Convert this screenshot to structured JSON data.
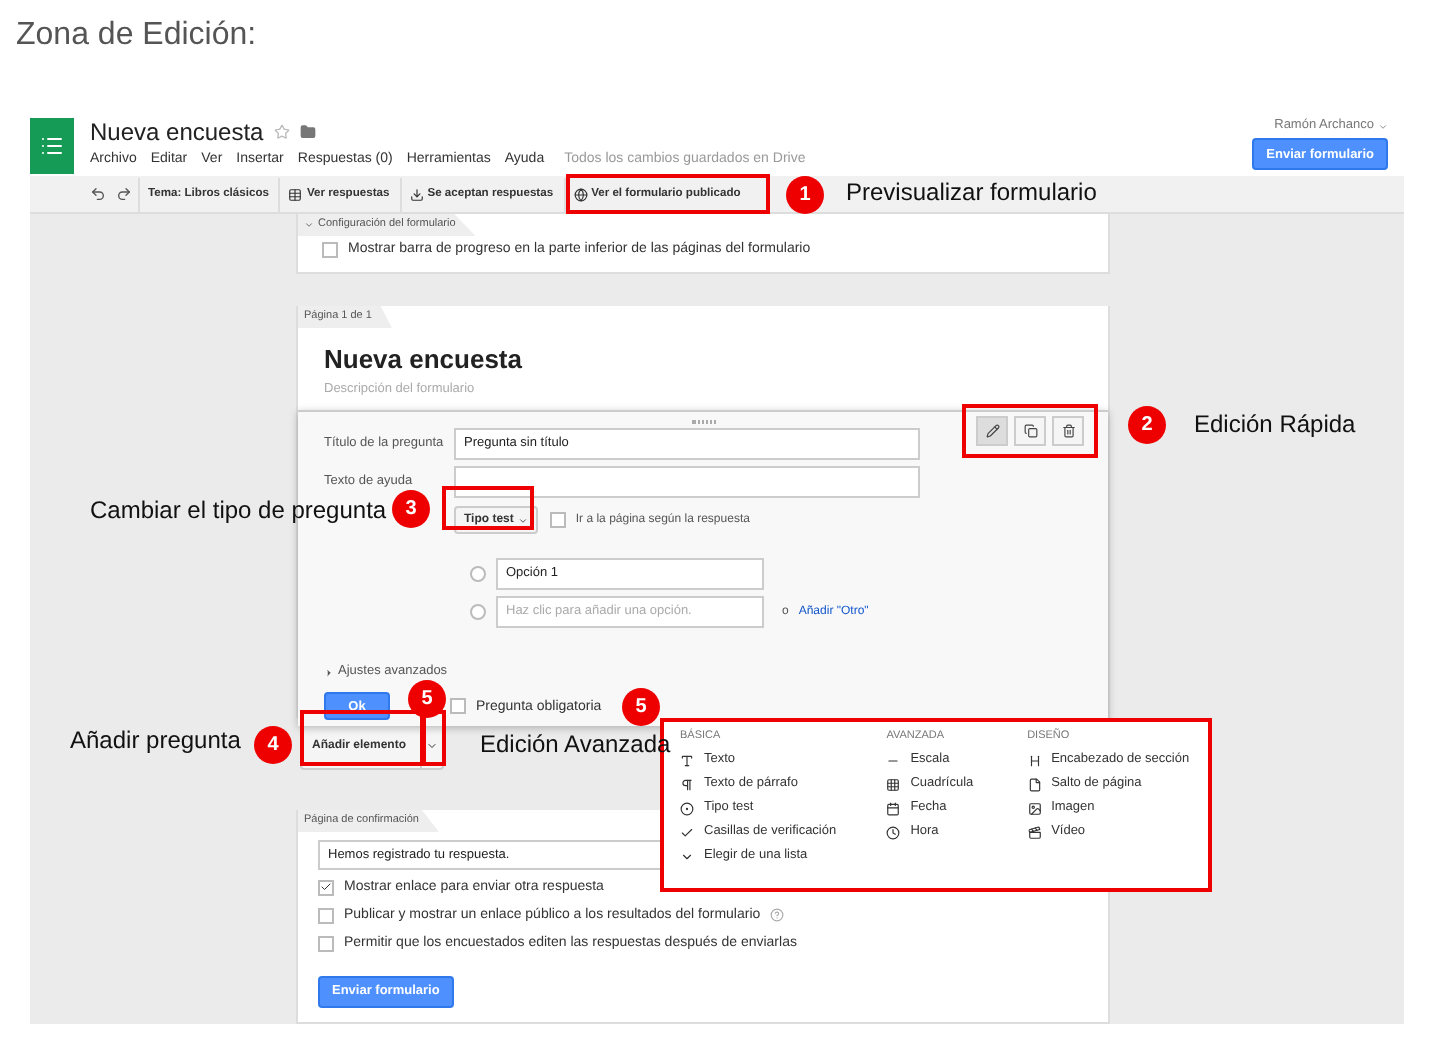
{
  "heading": "Zona de Edición:",
  "app": {
    "title": "Nueva encuesta",
    "starred": false,
    "menu": [
      "Archivo",
      "Editar",
      "Ver",
      "Insertar",
      "Respuestas (0)",
      "Herramientas",
      "Ayuda"
    ],
    "save_status": "Todos los cambios guardados en Drive",
    "user": "Ramón Archanco",
    "send_button": "Enviar formulario"
  },
  "toolbar": [
    {
      "kind": "text",
      "label": "Tema: Libros clásicos"
    },
    {
      "kind": "table",
      "label": "Ver respuestas"
    },
    {
      "kind": "inbox",
      "label": "Se aceptan respuestas"
    },
    {
      "kind": "globe",
      "label": "Ver el formulario publicado"
    }
  ],
  "settings": {
    "tab": "Configuración del formulario",
    "expanded": true,
    "options": [
      {
        "label": "Mostrar barra de progreso en la parte inferior de las páginas del formulario",
        "checked": false
      }
    ]
  },
  "page": {
    "tab": "Página 1 de 1",
    "title": "Nueva encuesta",
    "description": "Descripción del formulario"
  },
  "question_editor": {
    "fields": [
      {
        "label": "Título de la pregunta",
        "value": "Pregunta sin título"
      },
      {
        "label": "Texto de ayuda"
      }
    ],
    "type_button": "Tipo test",
    "page_jump": {
      "label": "Ir a la página según la respuesta",
      "checked": false
    },
    "options": [
      {
        "value": "Opción 1",
        "selected": false
      },
      {
        "placeholder": "Haz clic para añadir una opción.",
        "selected": false
      }
    ],
    "add_other_prefix": "o",
    "add_other_link": "Añadir \"Otro\"",
    "advanced": "Ajustes avanzados",
    "ok_button": "Ok",
    "required": {
      "label": "Pregunta obligatoria",
      "checked": false
    }
  },
  "add_item_button": "Añadir elemento",
  "confirmation": {
    "tab": "Página de confirmación",
    "message": "Hemos registrado tu respuesta.",
    "options": [
      {
        "label": "Mostrar enlace para enviar otra respuesta",
        "checked": true
      },
      {
        "label": "Publicar y mostrar un enlace público a los resultados del formulario",
        "checked": false,
        "help": true
      },
      {
        "label": "Permitir que los encuestados editen las respuestas después de enviarlas",
        "checked": false
      }
    ],
    "send_button": "Enviar formulario"
  },
  "insert_menu": {
    "columns": [
      {
        "heading": "BÁSICA",
        "items": [
          {
            "kind": "text",
            "label": "Texto"
          },
          {
            "kind": "paragraph",
            "label": "Texto de párrafo"
          },
          {
            "kind": "radio",
            "label": "Tipo test"
          },
          {
            "kind": "checkbox",
            "label": "Casillas de verificación"
          },
          {
            "kind": "list",
            "label": "Elegir de una lista"
          }
        ]
      },
      {
        "heading": "AVANZADA",
        "items": [
          {
            "kind": "scale",
            "label": "Escala"
          },
          {
            "kind": "grid",
            "label": "Cuadrícula"
          },
          {
            "kind": "date",
            "label": "Fecha"
          },
          {
            "kind": "time",
            "label": "Hora"
          }
        ]
      },
      {
        "heading": "DISEÑO",
        "items": [
          {
            "kind": "header",
            "label": "Encabezado de sección"
          },
          {
            "kind": "pagebreak",
            "label": "Salto de página"
          },
          {
            "kind": "image",
            "label": "Imagen"
          },
          {
            "kind": "video",
            "label": "Vídeo"
          }
        ]
      }
    ]
  },
  "callouts": [
    {
      "number": "1",
      "label": "Previsualizar formulario"
    },
    {
      "number": "2",
      "label": "Edición Rápida"
    },
    {
      "number": "3",
      "label": "Cambiar el tipo de pregunta"
    },
    {
      "number": "4",
      "label": "Añadir pregunta"
    },
    {
      "number": "5",
      "label": "Edición Avanzada"
    },
    {
      "number": "5"
    }
  ]
}
